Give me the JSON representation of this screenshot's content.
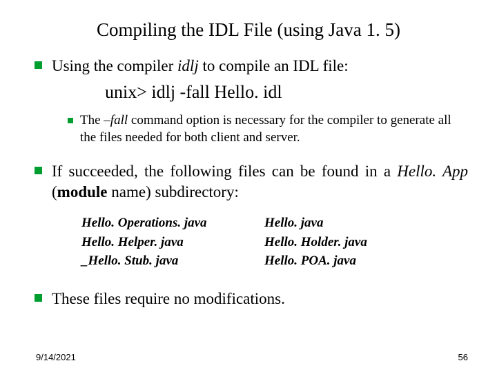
{
  "title": "Compiling the IDL File (using Java 1. 5)",
  "b1": {
    "pre": "Using the compiler ",
    "idlj": "idlj",
    "post": " to compile an IDL file:"
  },
  "cmd": {
    "prompt": "unix>",
    "rest": "  idlj -fall Hello. idl"
  },
  "sub1": {
    "a": "The ",
    "b": "–fall",
    "c": " command option is necessary for the compiler to generate ",
    "d": "all",
    "e": " the files needed for both ",
    "f": "client",
    "g": " and ",
    "h": "server",
    "i": "."
  },
  "b2": {
    "a": "If succeeded, the following files can be found in a ",
    "b": "Hello. App",
    "c": " (",
    "d": "module",
    "e": " name) subdirectory:"
  },
  "files": {
    "l1": "Hello. Operations. java",
    "l2": "Hello. Helper. java",
    "l3": "_Hello. Stub. java",
    "r1": "Hello. java",
    "r2": "Hello. Holder. java",
    "r3": "Hello. POA. java"
  },
  "b3": "These files require no modifications.",
  "footer": {
    "date": "9/14/2021",
    "page": "56"
  }
}
